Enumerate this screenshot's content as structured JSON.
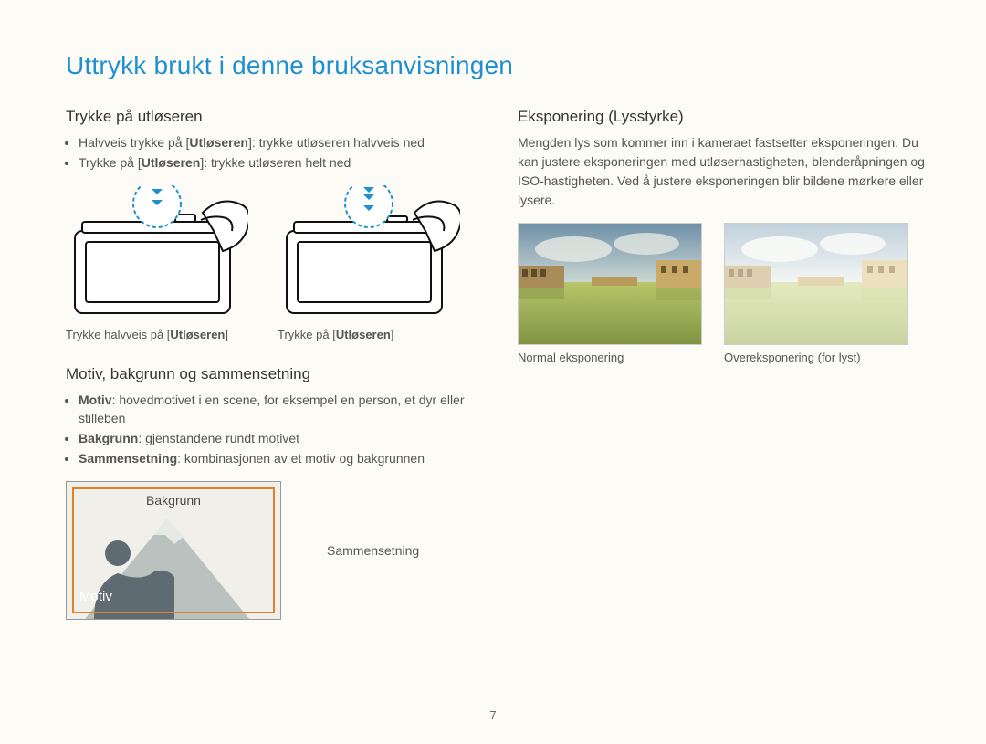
{
  "title": "Uttrykk brukt i denne bruksanvisningen",
  "page_number": "7",
  "left": {
    "shutter": {
      "heading": "Trykke på utløseren",
      "bullets": [
        {
          "pre": "Halvveis trykke på [",
          "bold": "Utløseren",
          "post": "]: trykke utløseren halvveis ned"
        },
        {
          "pre": "Trykke på [",
          "bold": "Utløseren",
          "post": "]: trykke utløseren helt ned"
        }
      ],
      "cap1": {
        "pre": "Trykke halvveis på [",
        "bold": "Utløseren",
        "post": "]"
      },
      "cap2": {
        "pre": "Trykke på [",
        "bold": "Utløseren",
        "post": "]"
      },
      "arrow1_name": "arrow-half-press",
      "arrow2_name": "arrow-full-press"
    },
    "composition": {
      "heading": "Motiv, bakgrunn og sammensetning",
      "bullets": [
        {
          "bold": "Motiv",
          "post": ": hovedmotivet i en scene, for eksempel en person, et dyr eller stilleben"
        },
        {
          "bold": "Bakgrunn",
          "post": ": gjenstandene rundt motivet"
        },
        {
          "bold": "Sammensetning",
          "post": ": kombinasjonen av et motiv og bakgrunnen"
        }
      ],
      "label_bg": "Bakgrunn",
      "label_motiv": "Motiv",
      "label_sammen": "Sammensetning"
    }
  },
  "right": {
    "exposure": {
      "heading": "Eksponering (Lysstyrke)",
      "body": "Mengden lys som kommer inn i kameraet fastsetter eksponeringen. Du kan justere eksponeringen med utløserhastigheten, blenderåpningen og ISO-hastigheten. Ved å justere eksponeringen blir bildene mørkere eller lysere.",
      "cap_normal": "Normal eksponering",
      "cap_over": "Overeksponering (for lyst)"
    }
  }
}
